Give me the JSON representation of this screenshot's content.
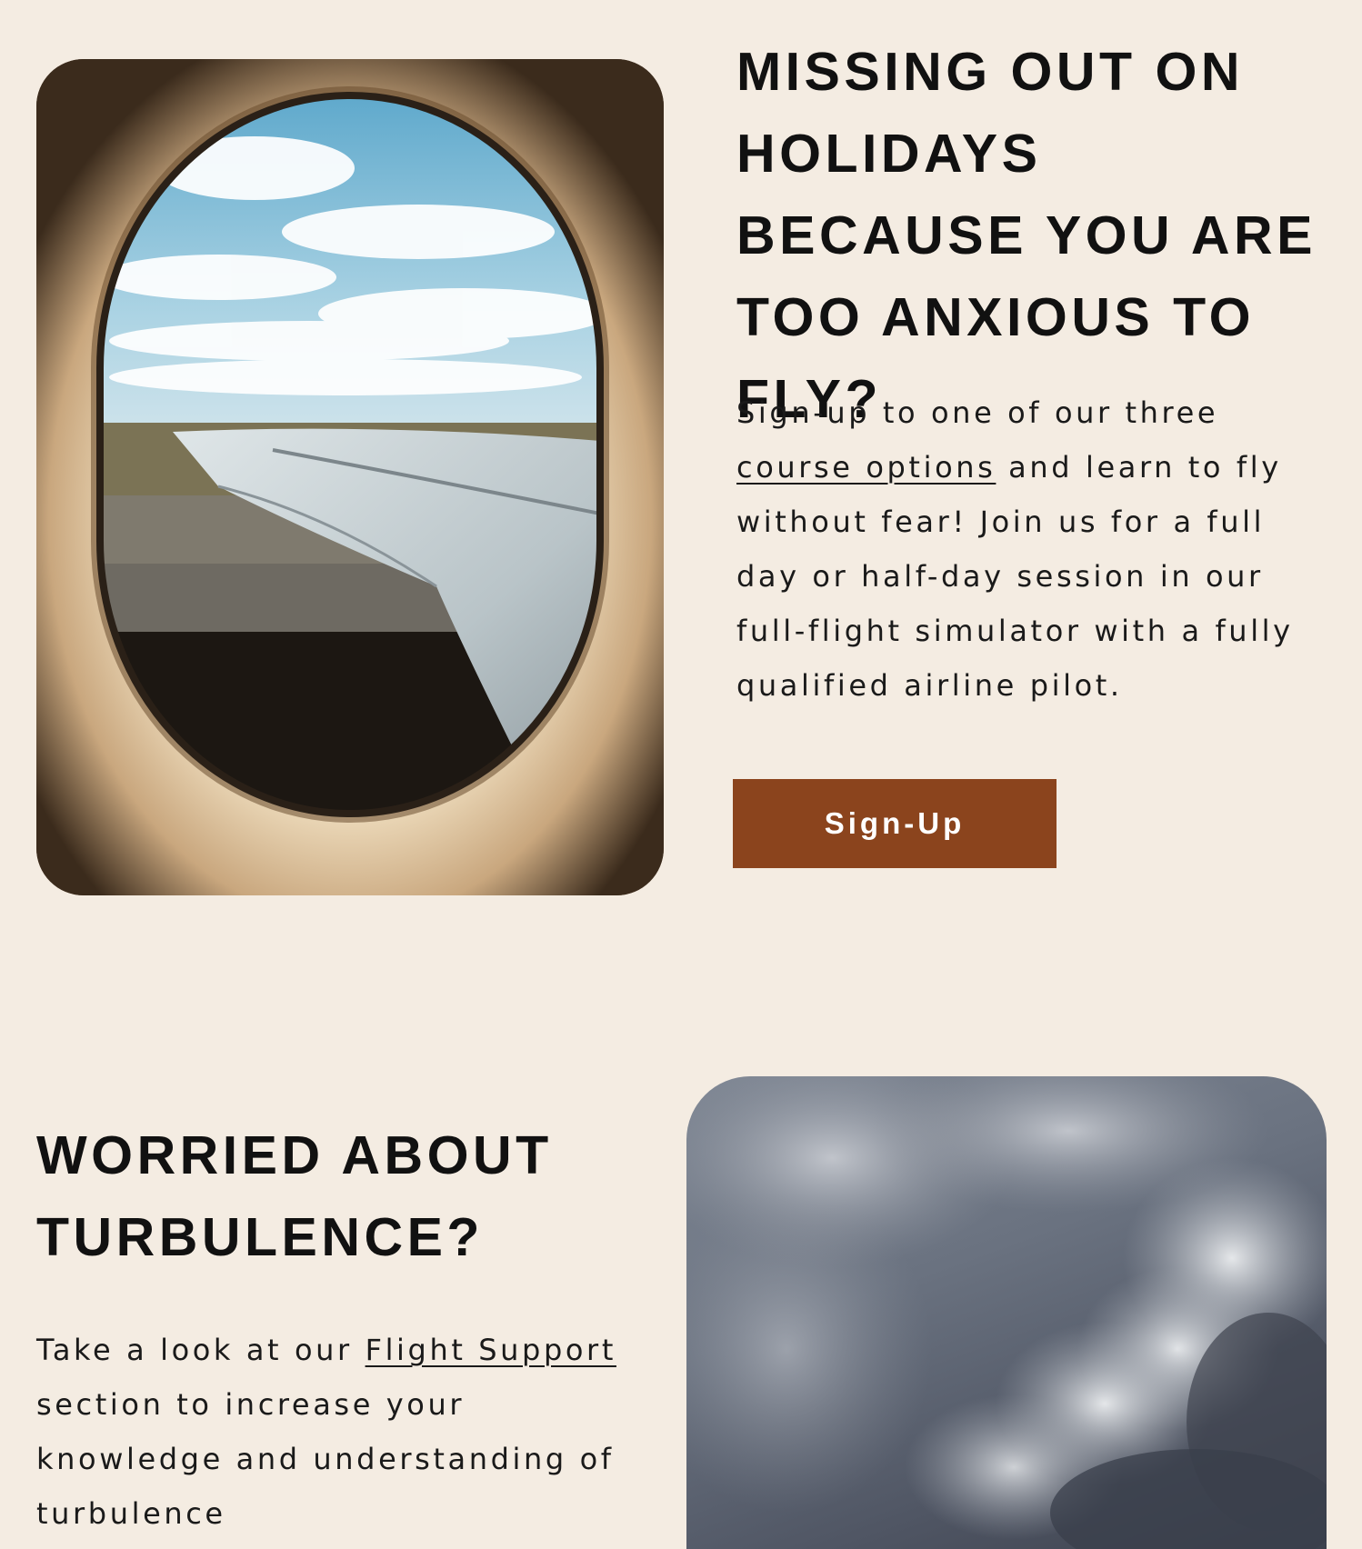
{
  "section_fly": {
    "image_name": "airplane-window-photo",
    "heading": "MISSING OUT ON HOLIDAYS BECAUSE YOU ARE TOO ANXIOUS TO FLY?",
    "text_before_link": "Sign-up to one of our three ",
    "link_label": "course options",
    "text_after_link": " and learn to fly without fear! Join us for a full day or half-day session in our full-flight simulator with a fully qualified airline pilot.",
    "button_label": "Sign-Up",
    "button_color": "#8b441d"
  },
  "section_turbulence": {
    "image_name": "storm-clouds-photo",
    "heading": "WORRIED ABOUT TURBULENCE?",
    "text_before_link": "Take a look at our ",
    "link_label": "Flight Support",
    "text_after_link": " section to increase your knowledge and understanding of turbulence"
  },
  "colors": {
    "background": "#f4ece2",
    "text": "#111111",
    "accent": "#8b441d"
  }
}
